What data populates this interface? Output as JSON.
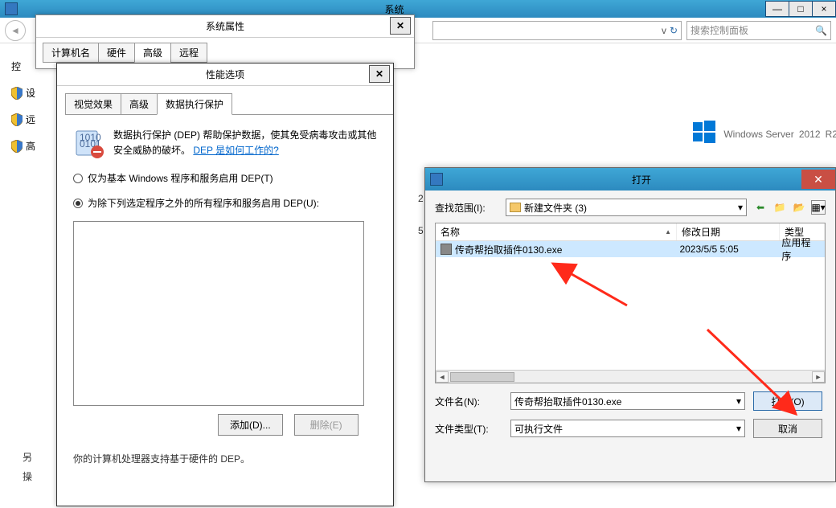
{
  "system_window": {
    "title": "系统",
    "min": "—",
    "max": "□",
    "close": "×"
  },
  "toolbar": {
    "search_placeholder": "搜索控制面板"
  },
  "cp_items": [
    "控",
    "设",
    "远",
    "高"
  ],
  "sysprops": {
    "title": "系统属性",
    "tabs": [
      "计算机名",
      "硬件",
      "高级",
      "远程"
    ],
    "active_tab": 2
  },
  "perf": {
    "title": "性能选项",
    "tabs": [
      "视觉效果",
      "高级",
      "数据执行保护"
    ],
    "active_tab": 2,
    "dep_desc_1": "数据执行保护 (DEP) 帮助保护数据，使其免受病毒攻击或其他安全威胁的破坏。",
    "dep_link": "DEP 是如何工作的?",
    "radio_basic": "仅为基本 Windows 程序和服务启用 DEP(T)",
    "radio_all": "为除下列选定程序之外的所有程序和服务启用 DEP(U):",
    "add_btn": "添加(D)...",
    "remove_btn": "删除(E)",
    "footnote": "你的计算机处理器支持基于硬件的 DEP。"
  },
  "brand": {
    "text_a": "Windows Server",
    "text_b": "2012",
    "text_c": "R2"
  },
  "open_dialog": {
    "title": "打开",
    "lookup_label": "查找范围(I):",
    "folder": "新建文件夹 (3)",
    "columns": {
      "name": "名称",
      "date": "修改日期",
      "type": "类型"
    },
    "file": {
      "name": "传奇帮抬取插件0130.exe",
      "date": "2023/5/5 5:05",
      "type": "应用程序"
    },
    "filename_label": "文件名(N):",
    "filename_value": "传奇帮抬取插件0130.exe",
    "filetype_label": "文件类型(T):",
    "filetype_value": "可执行文件",
    "open_btn": "打开(O)",
    "cancel_btn": "取消"
  },
  "bg_fragments": {
    "a": "2",
    "b": "5",
    "c": "另",
    "d": "操"
  },
  "arrows": {}
}
